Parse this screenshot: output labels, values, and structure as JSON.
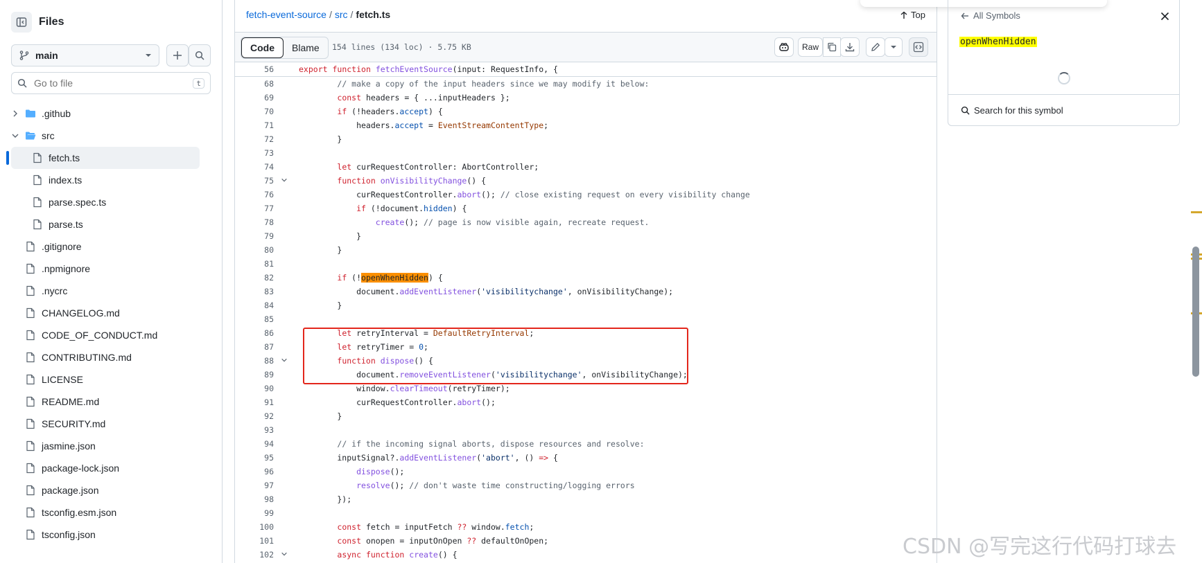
{
  "sidebar": {
    "title": "Files",
    "branch": "main",
    "search_placeholder": "Go to file",
    "search_shortcut": "t",
    "tree": [
      {
        "label": ".github",
        "type": "folder",
        "expanded": false,
        "depth": 0
      },
      {
        "label": "src",
        "type": "folder",
        "expanded": true,
        "depth": 0
      },
      {
        "label": "fetch.ts",
        "type": "file",
        "depth": 1,
        "selected": true
      },
      {
        "label": "index.ts",
        "type": "file",
        "depth": 1
      },
      {
        "label": "parse.spec.ts",
        "type": "file",
        "depth": 1
      },
      {
        "label": "parse.ts",
        "type": "file",
        "depth": 1
      },
      {
        "label": ".gitignore",
        "type": "file",
        "depth": 0
      },
      {
        "label": ".npmignore",
        "type": "file",
        "depth": 0
      },
      {
        "label": ".nycrc",
        "type": "file",
        "depth": 0
      },
      {
        "label": "CHANGELOG.md",
        "type": "file",
        "depth": 0
      },
      {
        "label": "CODE_OF_CONDUCT.md",
        "type": "file",
        "depth": 0
      },
      {
        "label": "CONTRIBUTING.md",
        "type": "file",
        "depth": 0
      },
      {
        "label": "LICENSE",
        "type": "file",
        "depth": 0
      },
      {
        "label": "README.md",
        "type": "file",
        "depth": 0
      },
      {
        "label": "SECURITY.md",
        "type": "file",
        "depth": 0
      },
      {
        "label": "jasmine.json",
        "type": "file",
        "depth": 0
      },
      {
        "label": "package-lock.json",
        "type": "file",
        "depth": 0
      },
      {
        "label": "package.json",
        "type": "file",
        "depth": 0
      },
      {
        "label": "tsconfig.esm.json",
        "type": "file",
        "depth": 0
      },
      {
        "label": "tsconfig.json",
        "type": "file",
        "depth": 0
      }
    ]
  },
  "breadcrumb": {
    "repo": "fetch-event-source",
    "dir": "src",
    "file": "fetch.ts",
    "sep": "/",
    "top_label": "Top"
  },
  "toolbar": {
    "code_label": "Code",
    "blame_label": "Blame",
    "meta": "154 lines (134 loc) · 5.75 KB",
    "raw_label": "Raw"
  },
  "code": {
    "sticky": {
      "n": "56",
      "html": "<span class='kw'>export</span> <span class='kw'>function</span> <span class='fn'>fetchEventSource</span>(input: RequestInfo, {"
    },
    "lines": [
      {
        "n": "68",
        "html": "        <span class='cm'>// make a copy of the input headers since we may modify it below:</span>"
      },
      {
        "n": "69",
        "html": "        <span class='kw'>const</span> headers = { ...inputHeaders };"
      },
      {
        "n": "70",
        "html": "        <span class='kw'>if</span> (!headers.<span class='pr'>accept</span>) {"
      },
      {
        "n": "71",
        "html": "            headers.<span class='pr'>accept</span> = <span class='cn'>EventStreamContentType</span>;"
      },
      {
        "n": "72",
        "html": "        }"
      },
      {
        "n": "73",
        "html": ""
      },
      {
        "n": "74",
        "html": "        <span class='kw'>let</span> curRequestController: AbortController;"
      },
      {
        "n": "75",
        "fold": true,
        "html": "        <span class='kw'>function</span> <span class='fn'>onVisibilityChange</span>() {"
      },
      {
        "n": "76",
        "html": "            curRequestController.<span class='fn'>abort</span>(); <span class='cm'>// close existing request on every visibility change</span>"
      },
      {
        "n": "77",
        "html": "            <span class='kw'>if</span> (!document.<span class='pr'>hidden</span>) {"
      },
      {
        "n": "78",
        "html": "                <span class='fn'>create</span>(); <span class='cm'>// page is now visible again, recreate request.</span>"
      },
      {
        "n": "79",
        "html": "            }"
      },
      {
        "n": "80",
        "html": "        }"
      },
      {
        "n": "81",
        "html": ""
      },
      {
        "n": "82",
        "html": "        <span class='kw'>if</span> (!<span class='hl'>openWhenHidden</span>) {"
      },
      {
        "n": "83",
        "html": "            document.<span class='fn'>addEventListener</span>(<span class='st'>'visibilitychange'</span>, onVisibilityChange);"
      },
      {
        "n": "84",
        "html": "        }"
      },
      {
        "n": "85",
        "html": ""
      },
      {
        "n": "86",
        "html": "        <span class='kw'>let</span> retryInterval = <span class='cn'>DefaultRetryInterval</span>;"
      },
      {
        "n": "87",
        "html": "        <span class='kw'>let</span> retryTimer = <span class='nu'>0</span>;"
      },
      {
        "n": "88",
        "fold": true,
        "html": "        <span class='kw'>function</span> <span class='fn'>dispose</span>() {"
      },
      {
        "n": "89",
        "html": "            document.<span class='fn'>removeEventListener</span>(<span class='st'>'visibilitychange'</span>, onVisibilityChange);"
      },
      {
        "n": "90",
        "html": "            window.<span class='fn'>clearTimeout</span>(retryTimer);"
      },
      {
        "n": "91",
        "html": "            curRequestController.<span class='fn'>abort</span>();"
      },
      {
        "n": "92",
        "html": "        }"
      },
      {
        "n": "93",
        "html": ""
      },
      {
        "n": "94",
        "html": "        <span class='cm'>// if the incoming signal aborts, dispose resources and resolve:</span>"
      },
      {
        "n": "95",
        "html": "        inputSignal?.<span class='fn'>addEventListener</span>(<span class='st'>'abort'</span>, () <span class='kw'>=&gt;</span> {"
      },
      {
        "n": "96",
        "html": "            <span class='fn'>dispose</span>();"
      },
      {
        "n": "97",
        "html": "            <span class='fn'>resolve</span>(); <span class='cm'>// don't waste time constructing/logging errors</span>"
      },
      {
        "n": "98",
        "html": "        });"
      },
      {
        "n": "99",
        "html": ""
      },
      {
        "n": "100",
        "html": "        <span class='kw'>const</span> fetch = inputFetch <span class='kw'>??</span> window.<span class='pr'>fetch</span>;"
      },
      {
        "n": "101",
        "html": "        <span class='kw'>const</span> onopen = inputOnOpen <span class='kw'>??</span> defaultOnOpen;"
      },
      {
        "n": "102",
        "fold": true,
        "html": "        <span class='kw'>async</span> <span class='kw'>function</span> <span class='fn'>create</span>() {"
      }
    ]
  },
  "symbols": {
    "back_label": "All Symbols",
    "symbol": "openWhenHidden",
    "search_label": "Search for this symbol"
  },
  "watermark": "CSDN @写完这行代码打球去"
}
